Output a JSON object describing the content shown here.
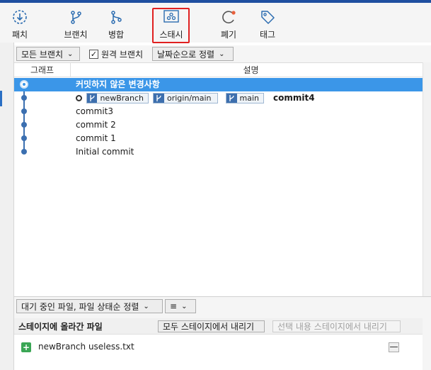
{
  "toolbar": {
    "commit": "패치",
    "branch": "브랜치",
    "merge": "병합",
    "stash": "스태시",
    "discard": "폐기",
    "tag": "태그"
  },
  "filters": {
    "branches": "모든 브랜치",
    "remote_branches": "원격 브랜치",
    "remote_checked": true,
    "sort": "날짜순으로 정렬"
  },
  "columns": {
    "graph": "그래프",
    "description": "설명"
  },
  "commits": [
    {
      "text": "커밋하지 않은 변경사항",
      "selected": true
    },
    {
      "text": "commit4",
      "refs": [
        "newBranch",
        "origin/main",
        "main"
      ],
      "head": true
    },
    {
      "text": "commit3"
    },
    {
      "text": "commit 2"
    },
    {
      "text": "commit 1"
    },
    {
      "text": "Initial commit"
    }
  ],
  "bottom": {
    "sort": "대기 중인 파일, 파일 상태순 정렬",
    "view_icon": "list-icon",
    "staged_title": "스테이지에 올라간 파일",
    "unstage_all": "모두 스테이지에서 내리기",
    "unstage_selected": "선택 내용 스테이지에서 내리기",
    "files": [
      {
        "name": "newBranch useless.txt",
        "status": "added"
      }
    ]
  },
  "colors": {
    "accent": "#3b96e8",
    "graph_line": "#3b6fb0",
    "stash_highlight": "#e02020",
    "added": "#3aa655"
  }
}
